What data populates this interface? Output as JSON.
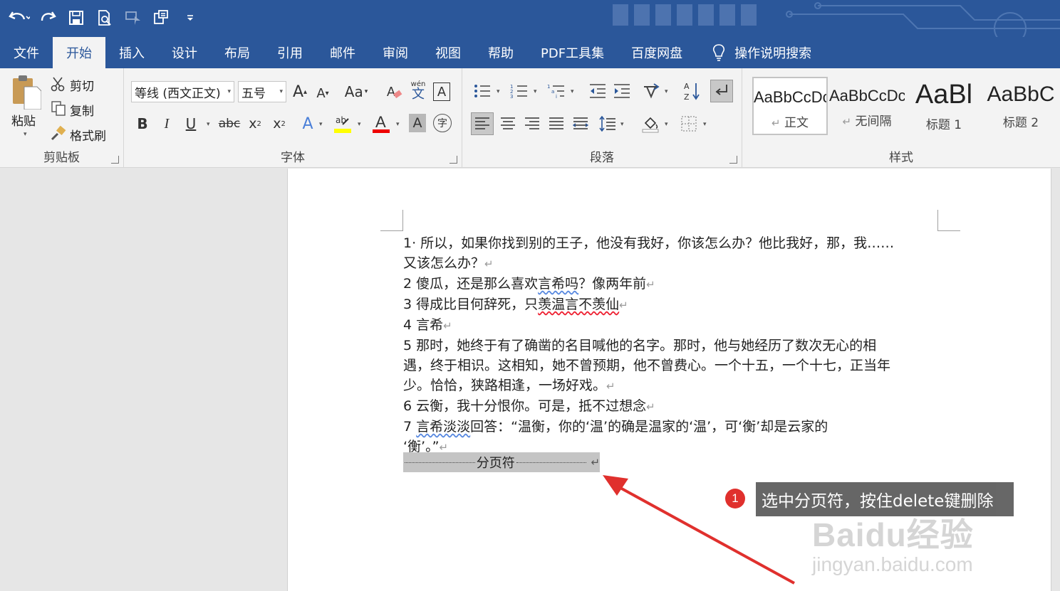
{
  "colors": {
    "accent": "#2b579a",
    "annotation_red": "#e0302d"
  },
  "qat": {
    "icons": [
      "undo-icon",
      "redo-icon",
      "save-icon",
      "print-preview-icon",
      "touch-mode-icon",
      "format-painter-icon",
      "customize-icon"
    ]
  },
  "tabs": [
    {
      "label": "文件"
    },
    {
      "label": "开始"
    },
    {
      "label": "插入"
    },
    {
      "label": "设计"
    },
    {
      "label": "布局"
    },
    {
      "label": "引用"
    },
    {
      "label": "邮件"
    },
    {
      "label": "审阅"
    },
    {
      "label": "视图"
    },
    {
      "label": "帮助"
    },
    {
      "label": "PDF工具集"
    },
    {
      "label": "百度网盘"
    }
  ],
  "tell_me": "操作说明搜索",
  "ribbon": {
    "clipboard": {
      "paste": "粘贴",
      "cut": "剪切",
      "copy": "复制",
      "format_painter": "格式刷",
      "label": "剪贴板"
    },
    "font": {
      "font_name": "等线 (西文正文)",
      "font_size": "五号",
      "change_case": "Aa",
      "bold": "B",
      "italic": "I",
      "underline": "U",
      "strike": "abc",
      "sub": "x",
      "sup": "x",
      "phonetic_top": "wén",
      "phonetic_bottom": "文",
      "label": "字体"
    },
    "paragraph": {
      "label": "段落"
    },
    "styles": {
      "items": [
        {
          "preview": "AaBbCcDc",
          "name": "正文",
          "mark": "↵"
        },
        {
          "preview": "AaBbCcDc",
          "name": "无间隔",
          "mark": "↵"
        },
        {
          "preview": "AaBl",
          "name": "标题 1"
        },
        {
          "preview": "AaBbC",
          "name": "标题 2"
        }
      ],
      "label": "样式"
    }
  },
  "document": {
    "lines": [
      {
        "num": "1",
        "text": "· 所以，如果你找到别的王子，他没有我好，你该怎么办？他比我好，那，我……"
      },
      {
        "num": "",
        "text": "又该怎么办？"
      },
      {
        "num": "2",
        "text_a": " 傻瓜，还是那么喜欢",
        "text_b": "言希吗",
        "text_c": "？像两年前"
      },
      {
        "num": "3",
        "text_a": " 得成比目何辞死，只",
        "text_b": "羡温言不羡仙"
      },
      {
        "num": "4",
        "text": " 言希"
      },
      {
        "num": "5",
        "text": " 那时，她终于有了确凿的名目喊他的名字。那时，他与她经历了数次无心的相"
      },
      {
        "num": "",
        "text": "遇，终于相识。这相知，她不曾预期，他不曾费心。一个十五，一个十七，正当年"
      },
      {
        "num": "",
        "text": "少。恰恰，狭路相逢，一场好戏。"
      },
      {
        "num": "6",
        "text": " 云衡，我十分恨你。可是，抵不过想念"
      },
      {
        "num": "7",
        "text_a": " ",
        "text_b": "言希淡淡",
        "text_c": "回答：“温衡，你的‘温’的确是温家的‘温’，可‘衡’却是云家的"
      },
      {
        "num": "",
        "text": "‘衡’。”"
      }
    ],
    "para_mark": "↵",
    "page_break": "分页符"
  },
  "annotation": {
    "number": "1",
    "text": "选中分页符，按住delete键删除"
  },
  "watermark": {
    "line1": "Baidu经验",
    "line2": "jingyan.baidu.com"
  }
}
